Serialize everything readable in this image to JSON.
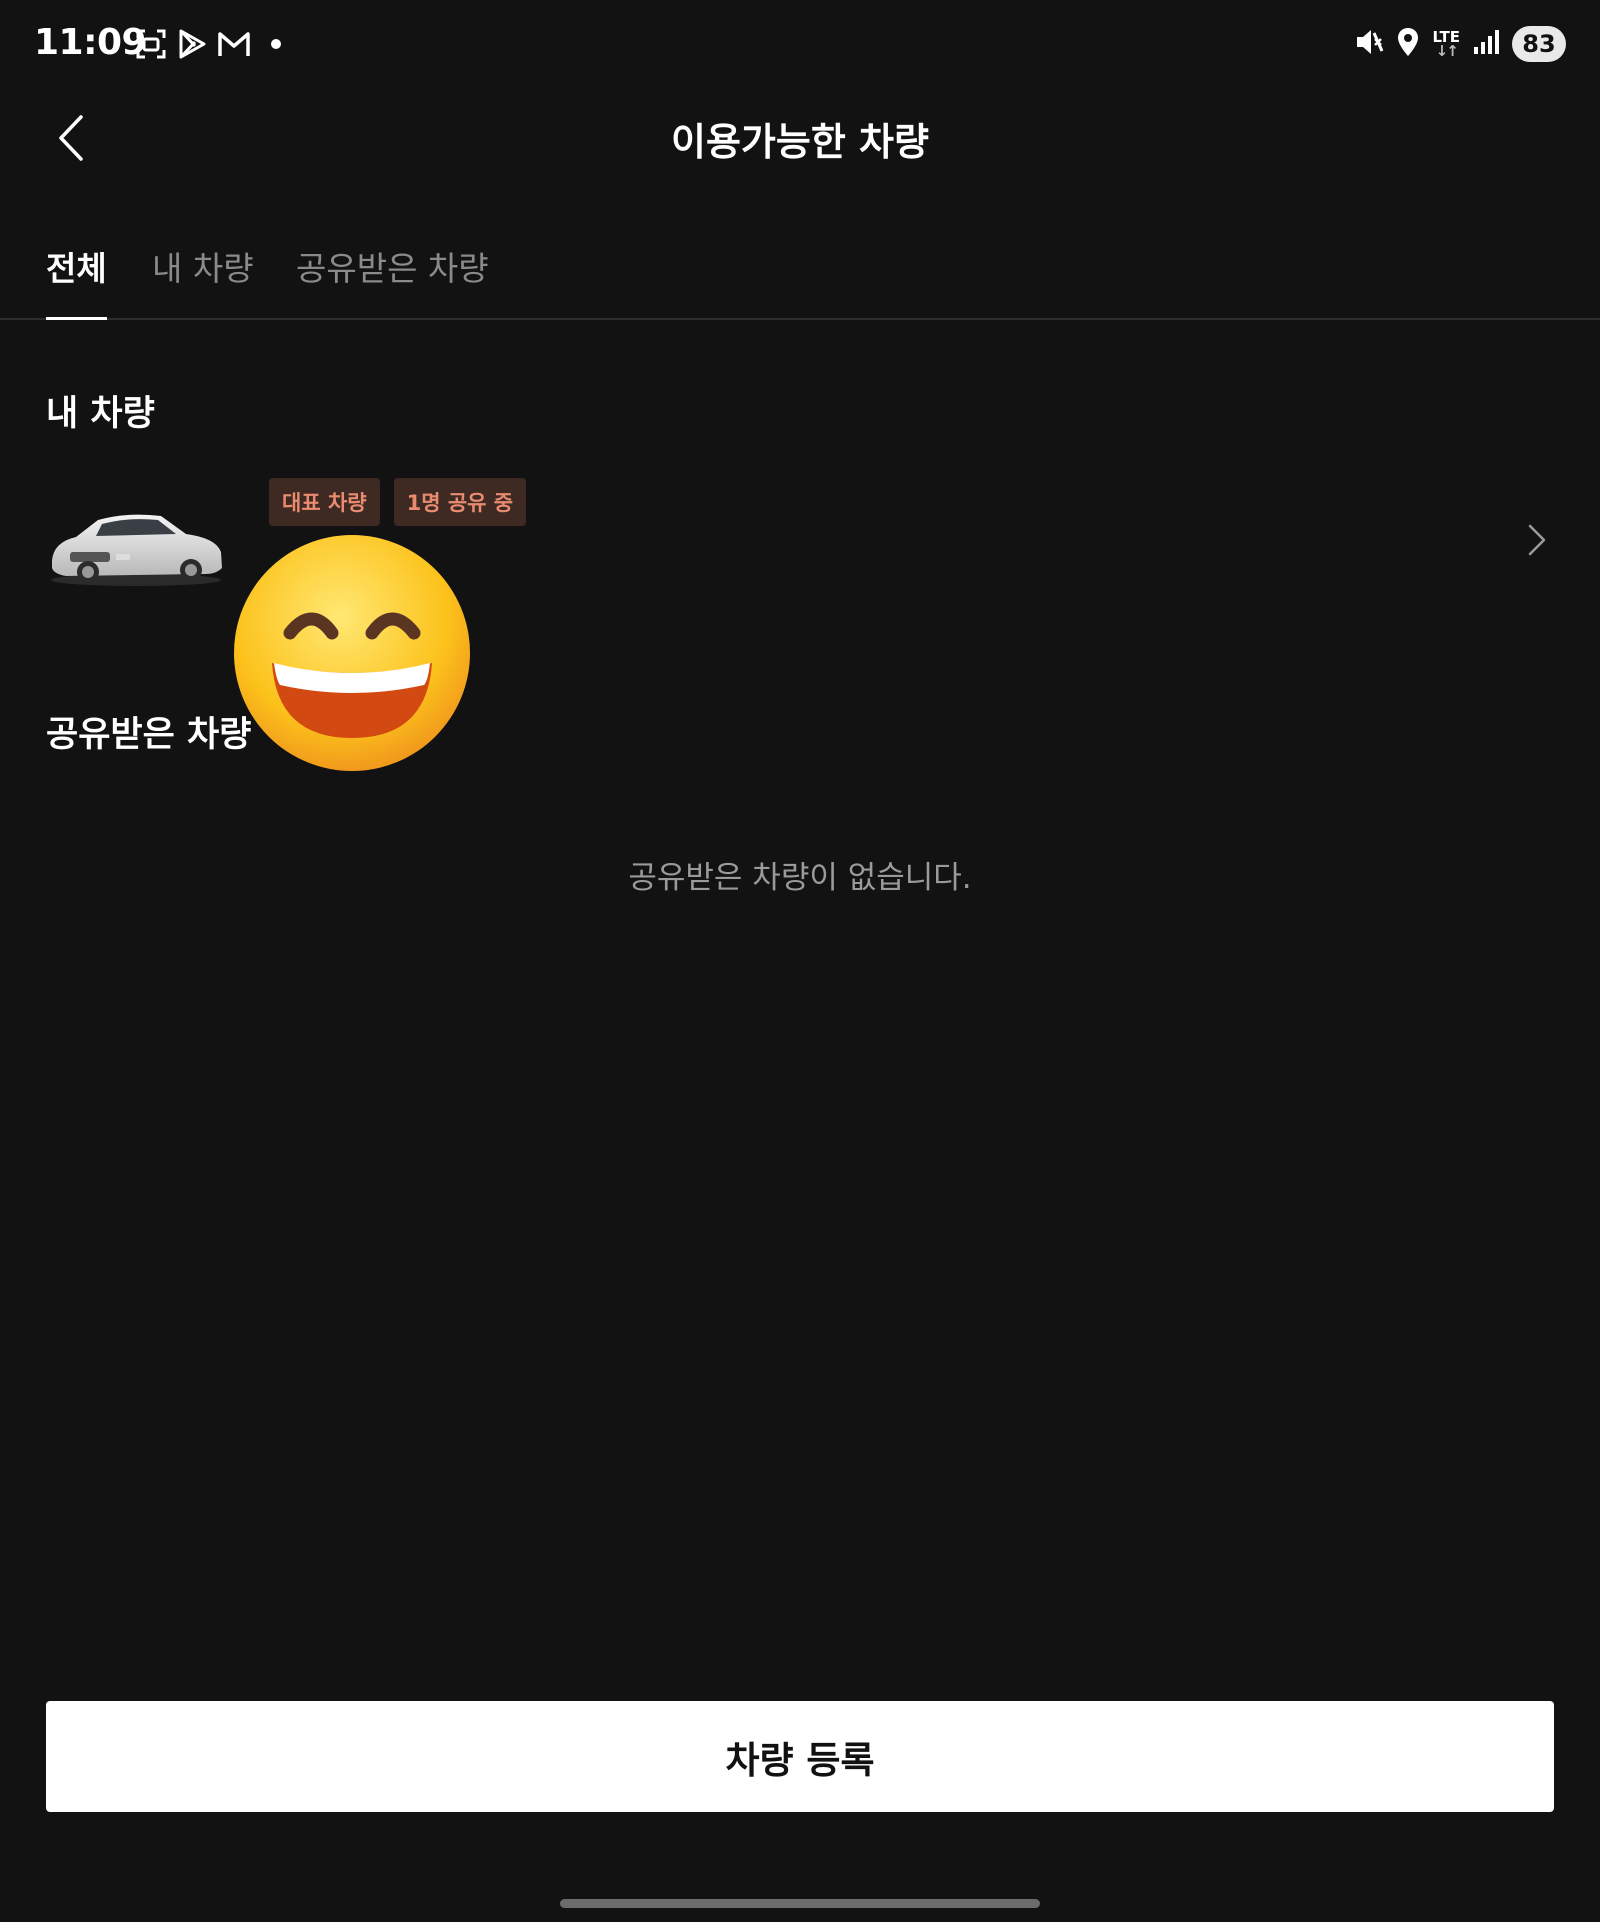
{
  "status_bar": {
    "time": "11:09",
    "left_icons": [
      "screenshot-icon",
      "play-store-icon",
      "gmail-icon",
      "dot-icon"
    ],
    "right_icons": [
      "mute-icon",
      "location-icon",
      "lte-icon",
      "signal-icon"
    ],
    "network": "LTE",
    "battery": "83"
  },
  "header": {
    "title": "이용가능한 차량",
    "back_icon": "chevron-left-icon"
  },
  "tabs": [
    {
      "label": "전체",
      "active": true
    },
    {
      "label": "내 차량",
      "active": false
    },
    {
      "label": "공유받은 차량",
      "active": false
    }
  ],
  "my_vehicles": {
    "title": "내 차량",
    "items": [
      {
        "badges": [
          "대표 차량",
          "1명 공유 중"
        ],
        "image": "car-image",
        "chevron": "chevron-right-icon"
      }
    ]
  },
  "shared_vehicles": {
    "title": "공유받은 차량",
    "empty_message": "공유받은 차량이 없습니다."
  },
  "footer": {
    "register_button": "차량 등록"
  },
  "overlay": {
    "emoji": "grinning-face-icon"
  },
  "colors": {
    "background": "#121212",
    "badge_bg": "#3e2923",
    "badge_text": "#e98b6f",
    "muted_text": "#9a9a9a"
  }
}
